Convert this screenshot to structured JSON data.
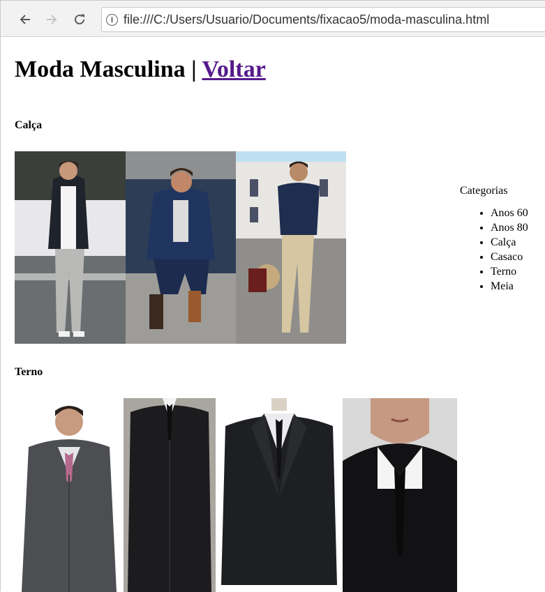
{
  "browser": {
    "url": "file:///C:/Users/Usuario/Documents/fixacao5/moda-masculina.html",
    "icons": {
      "back": "arrow-left-icon",
      "forward": "arrow-right-icon",
      "reload": "reload-icon",
      "info": "info-icon"
    }
  },
  "page": {
    "title": "Moda Masculina",
    "separator": " | ",
    "back_link": "Voltar"
  },
  "sections": [
    {
      "heading": "Calça",
      "photos": [
        "man-in-black-blazer-and-grey-pants",
        "man-in-navy-outfit-sitting",
        "man-in-navy-shirt-and-beige-pants"
      ]
    },
    {
      "heading": "Terno",
      "photos": [
        "man-in-grey-pinstripe-suit",
        "man-in-black-suit",
        "black-suit-on-mannequin",
        "suit-and-tie-closeup"
      ]
    }
  ],
  "sidebar": {
    "title": "Categorias",
    "items": [
      "Anos 60",
      "Anos 80",
      "Calça",
      "Casaco",
      "Terno",
      "Meia"
    ]
  }
}
